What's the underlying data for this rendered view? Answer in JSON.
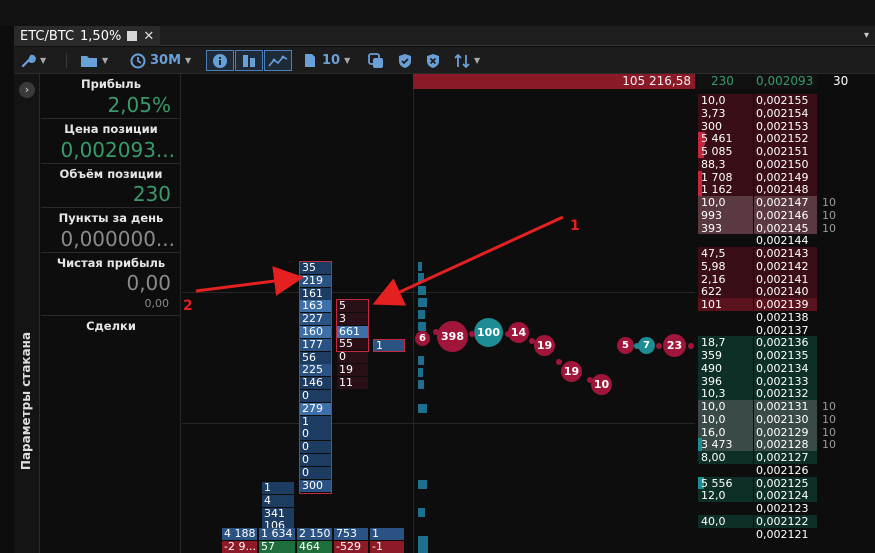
{
  "window": {
    "tab_title": "ETC/BTC",
    "tab_percent": "1,50%",
    "close_glyph": "✕",
    "scroll_glyph": "▾"
  },
  "toolbar": {
    "timeframe": "30M",
    "depth_count": "10",
    "icons": [
      "wrench-icon",
      "folder-icon",
      "clock-icon",
      "info-icon",
      "bars-icon",
      "line-icon",
      "document-icon",
      "layers-icon",
      "shield-check-icon",
      "shield-x-icon",
      "sort-arrows-icon"
    ]
  },
  "side_panel": {
    "vertical_label": "Параметры стакана",
    "expand_glyph": "›"
  },
  "metrics": [
    {
      "label": "Прибыль",
      "value": "2,05%"
    },
    {
      "label": "Цена позиции",
      "value": "0,002093..."
    },
    {
      "label": "Объём позиции",
      "value": "230"
    },
    {
      "label": "Пункты за день",
      "value": "0,000000..."
    },
    {
      "label": "Чистая прибыль",
      "value": "0,00",
      "sub": "0,00"
    },
    {
      "label": "Сделки"
    }
  ],
  "price_bar": "105 216,58",
  "cluster_col1": [
    "35",
    "219",
    "161",
    "163",
    "227",
    "160",
    "177",
    "56",
    "225",
    "146",
    "0",
    "279",
    "1",
    "0",
    "0",
    "0",
    "0",
    "300"
  ],
  "cluster_col2": [
    "5",
    "3",
    "661",
    "55",
    "0",
    "19",
    "11"
  ],
  "cluster_col3": [
    "1"
  ],
  "lower_col": [
    "1",
    "4",
    "341",
    "106"
  ],
  "bottom_row1": [
    "4 188",
    "1 634",
    "2 150",
    "753",
    "1"
  ],
  "bottom_row2": [
    "-2 9...",
    "57",
    "464",
    "-529",
    "-1"
  ],
  "bubbles": [
    {
      "label": "6",
      "color": "red"
    },
    {
      "label": "398",
      "color": "red"
    },
    {
      "label": "100",
      "color": "teal"
    },
    {
      "label": "14",
      "color": "red"
    },
    {
      "label": "19",
      "color": "red"
    },
    {
      "label": "19",
      "color": "red"
    },
    {
      "label": "10",
      "color": "red"
    },
    {
      "label": "5",
      "color": "red"
    },
    {
      "label": "7",
      "color": "teal"
    },
    {
      "label": "23",
      "color": "red"
    }
  ],
  "orderbook": {
    "header_volume": "230",
    "header_price": "0,002093",
    "header_extra": "30",
    "rows": [
      {
        "vol": "10,0",
        "price": "0,002155",
        "side": "ask",
        "fill": 0,
        "extra": ""
      },
      {
        "vol": "3,73",
        "price": "0,002154",
        "side": "ask",
        "fill": 0,
        "extra": ""
      },
      {
        "vol": "300",
        "price": "0,002153",
        "side": "ask",
        "fill": 0,
        "extra": ""
      },
      {
        "vol": "5 461",
        "price": "0,002152",
        "side": "ask",
        "fill": 0.12,
        "extra": ""
      },
      {
        "vol": "5 085",
        "price": "0,002151",
        "side": "ask",
        "fill": 0.11,
        "extra": ""
      },
      {
        "vol": "88,3",
        "price": "0,002150",
        "side": "ask",
        "fill": 0,
        "extra": ""
      },
      {
        "vol": "1 708",
        "price": "0,002149",
        "side": "ask",
        "fill": 0.04,
        "extra": ""
      },
      {
        "vol": "1 162",
        "price": "0,002148",
        "side": "ask",
        "fill": 0.03,
        "extra": ""
      },
      {
        "vol": "10,0",
        "price": "0,002147",
        "side": "ask-hl",
        "fill": 0,
        "extra": "10"
      },
      {
        "vol": "993",
        "price": "0,002146",
        "side": "ask-hl",
        "fill": 0,
        "extra": "10"
      },
      {
        "vol": "393",
        "price": "0,002145",
        "side": "ask-hl",
        "fill": 0,
        "extra": "10"
      },
      {
        "vol": "",
        "price": "0,002144",
        "side": "empty",
        "fill": 0,
        "extra": ""
      },
      {
        "vol": "47,5",
        "price": "0,002143",
        "side": "ask",
        "fill": 0,
        "extra": ""
      },
      {
        "vol": "5,98",
        "price": "0,002142",
        "side": "ask",
        "fill": 0,
        "extra": ""
      },
      {
        "vol": "2,16",
        "price": "0,002141",
        "side": "ask",
        "fill": 0,
        "extra": ""
      },
      {
        "vol": "622",
        "price": "0,002140",
        "side": "ask",
        "fill": 0,
        "extra": ""
      },
      {
        "vol": "101",
        "price": "0,002139",
        "side": "ask-best",
        "fill": 0,
        "extra": ""
      },
      {
        "vol": "",
        "price": "0,002138",
        "side": "empty",
        "fill": 0,
        "extra": ""
      },
      {
        "vol": "",
        "price": "0,002137",
        "side": "empty",
        "fill": 0,
        "extra": ""
      },
      {
        "vol": "18,7",
        "price": "0,002136",
        "side": "bid",
        "fill": 0,
        "extra": ""
      },
      {
        "vol": "359",
        "price": "0,002135",
        "side": "bid",
        "fill": 0,
        "extra": ""
      },
      {
        "vol": "490",
        "price": "0,002134",
        "side": "bid",
        "fill": 0,
        "extra": ""
      },
      {
        "vol": "396",
        "price": "0,002133",
        "side": "bid",
        "fill": 0,
        "extra": ""
      },
      {
        "vol": "10,3",
        "price": "0,002132",
        "side": "bid",
        "fill": 0,
        "extra": ""
      },
      {
        "vol": "10,0",
        "price": "0,002131",
        "side": "bid-hl",
        "fill": 0,
        "extra": "10"
      },
      {
        "vol": "10,0",
        "price": "0,002130",
        "side": "bid-hl",
        "fill": 0,
        "extra": "10"
      },
      {
        "vol": "16,0",
        "price": "0,002129",
        "side": "bid-hl",
        "fill": 0,
        "extra": "10"
      },
      {
        "vol": "3 473",
        "price": "0,002128",
        "side": "bid-hl",
        "fill": 0.06,
        "extra": "10"
      },
      {
        "vol": "8,00",
        "price": "0,002127",
        "side": "bid",
        "fill": 0,
        "extra": ""
      },
      {
        "vol": "",
        "price": "0,002126",
        "side": "empty",
        "fill": 0,
        "extra": ""
      },
      {
        "vol": "5 556",
        "price": "0,002125",
        "side": "bid",
        "fill": 0.1,
        "extra": ""
      },
      {
        "vol": "12,0",
        "price": "0,002124",
        "side": "bid",
        "fill": 0,
        "extra": ""
      },
      {
        "vol": "",
        "price": "0,002123",
        "side": "empty",
        "fill": 0,
        "extra": ""
      },
      {
        "vol": "40,0",
        "price": "0,002122",
        "side": "bid",
        "fill": 0,
        "extra": ""
      },
      {
        "vol": "",
        "price": "0,002121",
        "side": "empty",
        "fill": 0,
        "extra": ""
      }
    ]
  },
  "annotations": {
    "label1": "1",
    "label2": "2"
  },
  "colors": {
    "ask": "#3a0e16",
    "ask_hl": "#5a3a40",
    "bid": "#0e2e28",
    "bid_hl": "#3a4a48",
    "profit": "#3a9a6a",
    "accent": "#6aa0d8",
    "annotation": "#e42020"
  }
}
